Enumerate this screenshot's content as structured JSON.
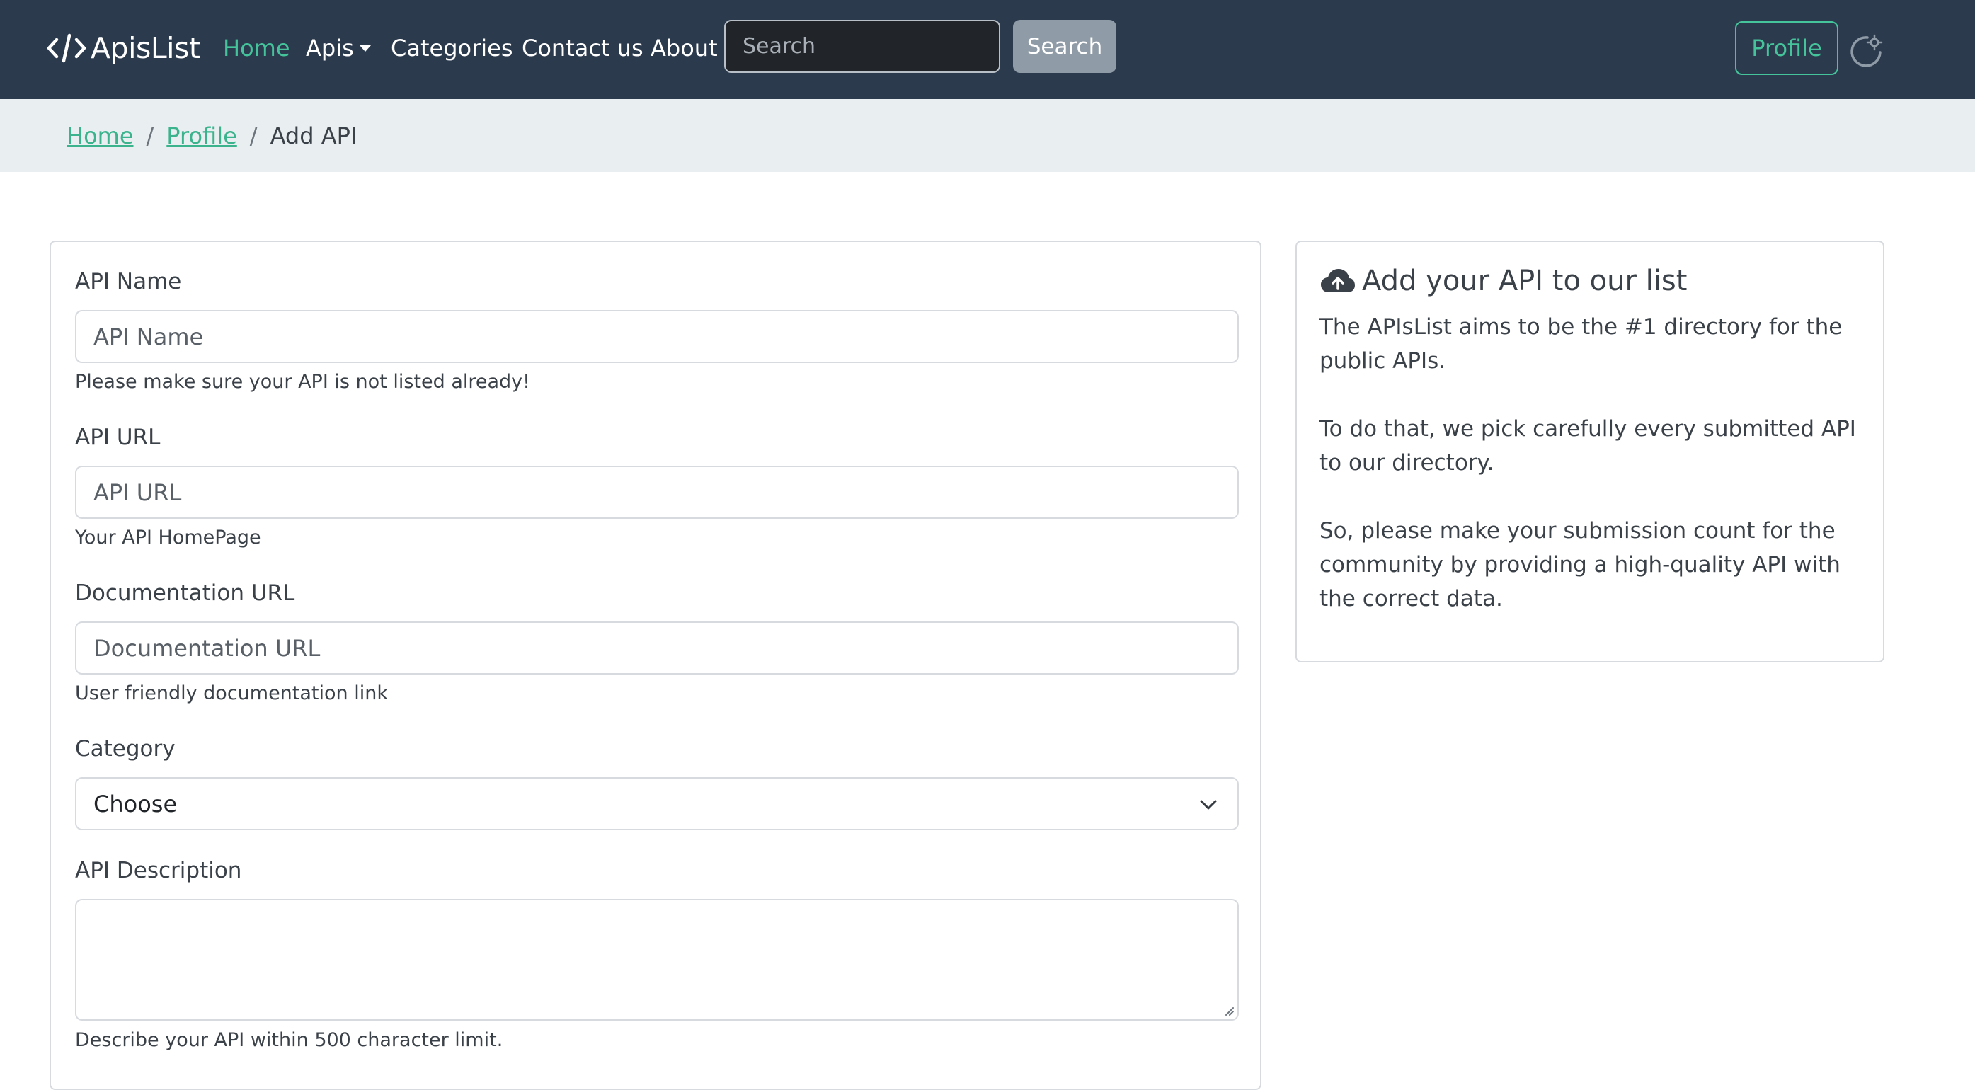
{
  "navbar": {
    "brand": "ApisList",
    "links": {
      "home": "Home",
      "apis": "Apis",
      "categories": "Categories",
      "contact": "Contact us",
      "about": "About"
    },
    "search_placeholder": "Search",
    "search_button": "Search",
    "profile_button": "Profile",
    "brand_color": "#45c39a",
    "bg_color": "#2c3a4e"
  },
  "breadcrumb": {
    "home": "Home",
    "profile": "Profile",
    "separator": "/",
    "current": "Add API"
  },
  "form": {
    "api_name": {
      "label": "API Name",
      "placeholder": "API Name",
      "help": "Please make sure your API is not listed already!"
    },
    "api_url": {
      "label": "API URL",
      "placeholder": "API URL",
      "help": "Your API HomePage"
    },
    "doc_url": {
      "label": "Documentation URL",
      "placeholder": "Documentation URL",
      "help": "User friendly documentation link"
    },
    "category": {
      "label": "Category",
      "selected": "Choose"
    },
    "description": {
      "label": "API Description",
      "help": "Describe your API within 500 character limit."
    }
  },
  "info": {
    "title": "Add your API to our list",
    "paragraphs": [
      "The APIsList aims to be the #1 directory for the public APIs.",
      "To do that, we pick carefully every submitted API to our directory.",
      "So, please make your submission count for the community by providing a high-quality API with the correct data."
    ]
  }
}
